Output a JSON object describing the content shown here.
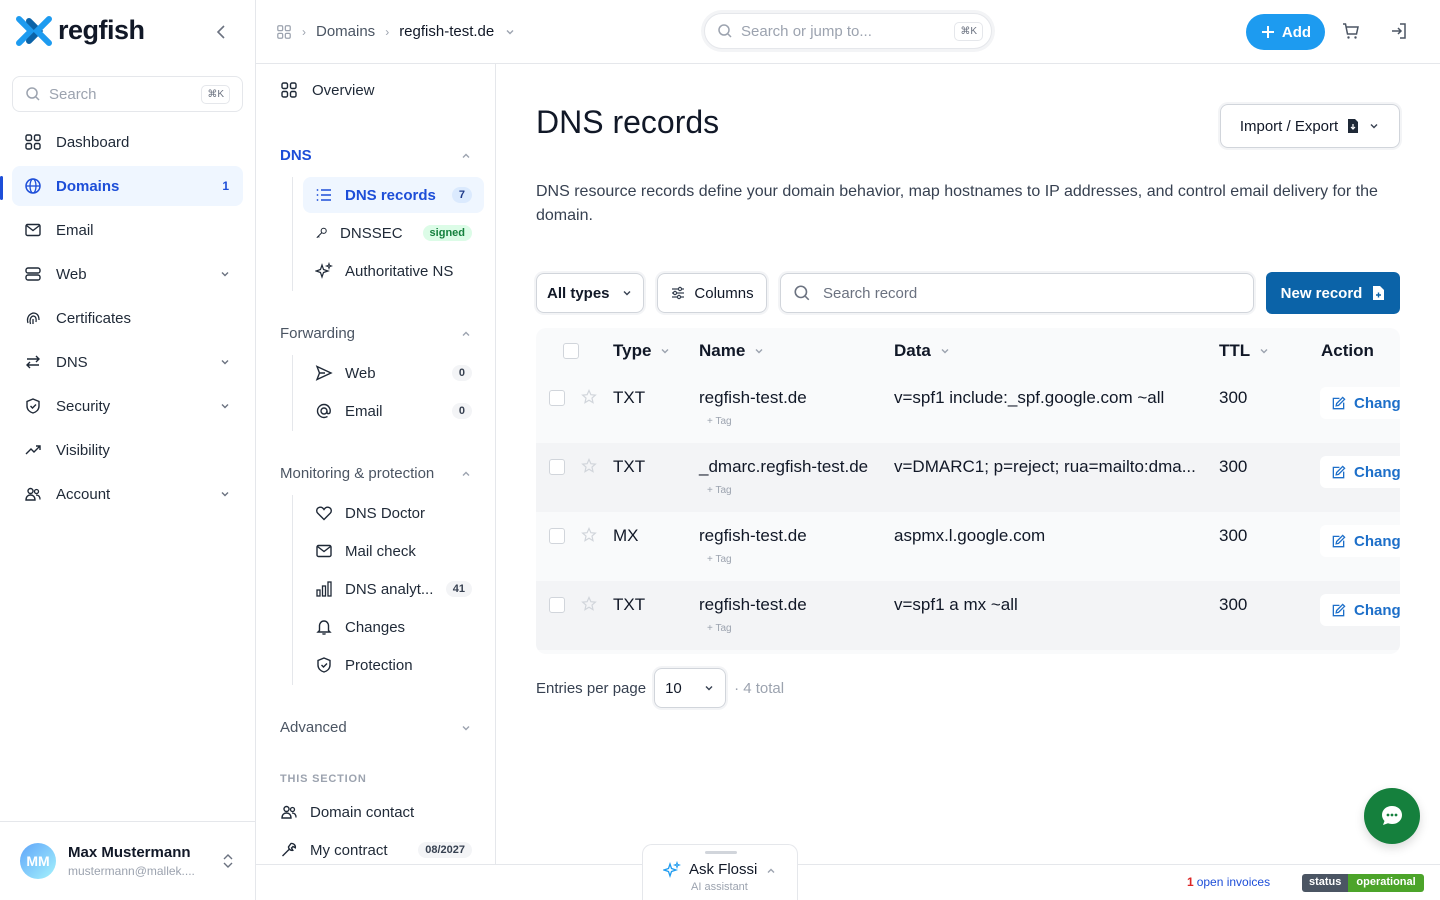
{
  "app": {
    "name": "regfish"
  },
  "sidebar": {
    "search_placeholder": "Search",
    "search_shortcut": "⌘K",
    "items": [
      {
        "label": "Dashboard",
        "icon": "grid-icon"
      },
      {
        "label": "Domains",
        "icon": "globe-icon",
        "count": "1",
        "active": true
      },
      {
        "label": "Email",
        "icon": "mail-icon"
      },
      {
        "label": "Web",
        "icon": "server-icon",
        "expandable": true
      },
      {
        "label": "Certificates",
        "icon": "fingerprint-icon"
      },
      {
        "label": "DNS",
        "icon": "arrows-icon",
        "expandable": true
      },
      {
        "label": "Security",
        "icon": "shield-icon",
        "expandable": true
      },
      {
        "label": "Visibility",
        "icon": "trend-icon"
      },
      {
        "label": "Account",
        "icon": "users-icon",
        "expandable": true
      }
    ],
    "user": {
      "initials": "MM",
      "name": "Max Mustermann",
      "email": "mustermann@mallek...."
    }
  },
  "topbar": {
    "breadcrumb": [
      "Domains",
      "regfish-test.de"
    ],
    "search_placeholder": "Search or jump to...",
    "search_shortcut": "⌘K",
    "add_label": "Add"
  },
  "subnav": {
    "overview": "Overview",
    "dns": {
      "title": "DNS",
      "items": [
        {
          "label": "DNS records",
          "pill": "7",
          "active": true
        },
        {
          "label": "DNSSEC",
          "badge": "signed"
        },
        {
          "label": "Authoritative NS"
        }
      ]
    },
    "forwarding": {
      "title": "Forwarding",
      "items": [
        {
          "label": "Web",
          "pill": "0"
        },
        {
          "label": "Email",
          "pill": "0"
        }
      ]
    },
    "monitoring": {
      "title": "Monitoring & protection",
      "items": [
        {
          "label": "DNS Doctor"
        },
        {
          "label": "Mail check"
        },
        {
          "label": "DNS analyt...",
          "pill": "41"
        },
        {
          "label": "Changes"
        },
        {
          "label": "Protection"
        }
      ]
    },
    "advanced": "Advanced",
    "this_section": "THIS SECTION",
    "domain_contact": "Domain contact",
    "my_contract": "My contract",
    "contract_date": "08/2027"
  },
  "main": {
    "title": "DNS records",
    "import_export": "Import / Export",
    "description": "DNS resource records define your domain behavior, map hostnames to IP addresses, and control email delivery for the domain.",
    "filter_types": "All types",
    "columns": "Columns",
    "search_placeholder": "Search record",
    "new_record": "New record",
    "table": {
      "headers": {
        "type": "Type",
        "name": "Name",
        "data": "Data",
        "ttl": "TTL",
        "action": "Action"
      },
      "rows": [
        {
          "type": "TXT",
          "name": "regfish-test.de",
          "data": "v=spf1 include:_spf.google.com ~all",
          "ttl": "300",
          "tag": "+ Tag",
          "action": "Change"
        },
        {
          "type": "TXT",
          "name": "_dmarc.regfish-test.de",
          "data": "v=DMARC1; p=reject; rua=mailto:dma...",
          "ttl": "300",
          "tag": "+ Tag",
          "action": "Change"
        },
        {
          "type": "MX",
          "name": "regfish-test.de",
          "data": "aspmx.l.google.com",
          "ttl": "300",
          "tag": "+ Tag",
          "action": "Change"
        },
        {
          "type": "TXT",
          "name": "regfish-test.de",
          "data": "v=spf1 a mx ~all",
          "ttl": "300",
          "tag": "+ Tag",
          "action": "Change"
        }
      ]
    },
    "pager": {
      "label": "Entries per page",
      "per_page": "10",
      "total": "· 4 total"
    }
  },
  "footer": {
    "ask_title": "Ask Flossi",
    "ask_sub": "AI assistant",
    "invoice_count": "1",
    "invoice_label": "open invoices",
    "status_key": "status",
    "status_value": "operational"
  },
  "colors": {
    "accent": "#1d4ed8",
    "add_button": "#1d9bf0",
    "new_record": "#0b63a8",
    "chat": "#15803d",
    "status_ok": "#4ca42a"
  }
}
